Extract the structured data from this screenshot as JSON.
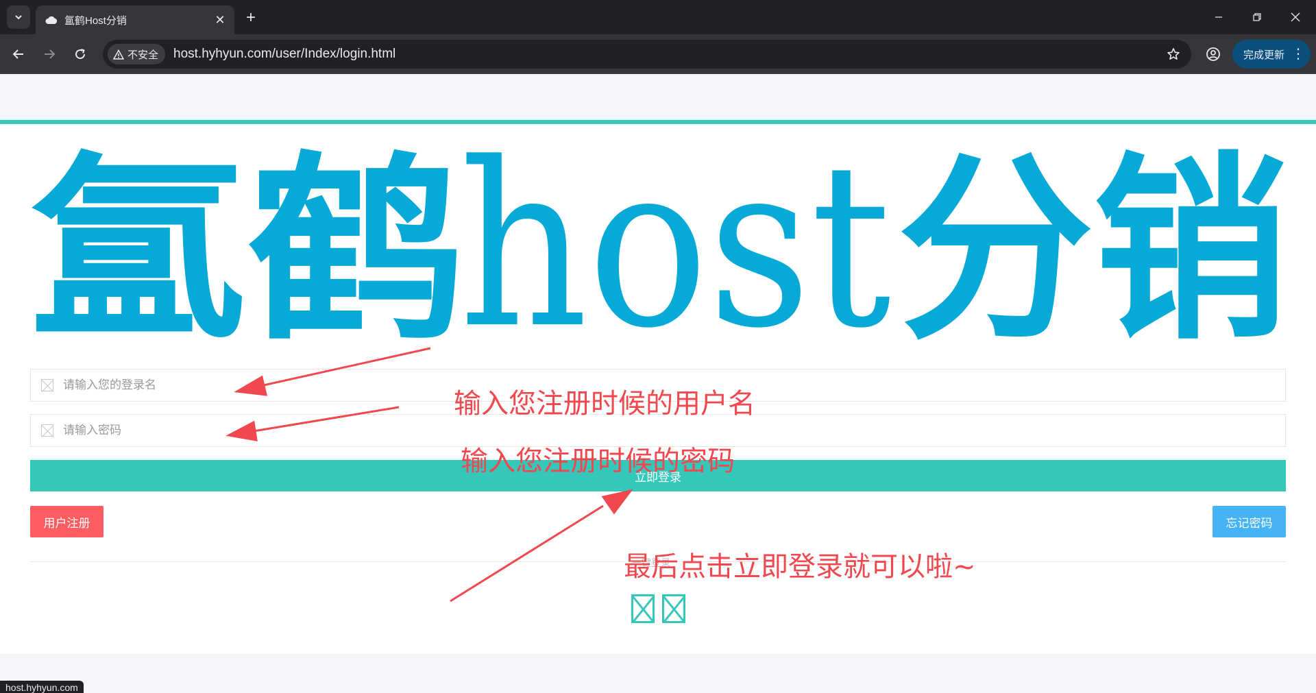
{
  "browser": {
    "tab_title": "氲鹤Host分销",
    "insecure_label": "不安全",
    "url": "host.hyhyun.com/user/Index/login.html",
    "update_label": "完成更新",
    "status_url": "host.hyhyun.com"
  },
  "logo": {
    "text_cn1": "氲鹤",
    "text_en": "host",
    "text_cn2": "分销",
    "color": "#07a9d6"
  },
  "form": {
    "username_placeholder": "请输入您的登录名",
    "password_placeholder": "请输入密码",
    "login_label": "立即登录",
    "register_label": "用户注册",
    "forgot_label": "忘记密码",
    "divider_text": "一键登录"
  },
  "annotations": {
    "username_hint": "输入您注册时候的用户名",
    "password_hint": "输入您注册时候的密码",
    "login_hint": "最后点击立即登录就可以啦~"
  },
  "colors": {
    "accent": "#36c7bb",
    "register": "#ff5d62",
    "forgot": "#45b3f5",
    "annotation": "#f0484e"
  }
}
